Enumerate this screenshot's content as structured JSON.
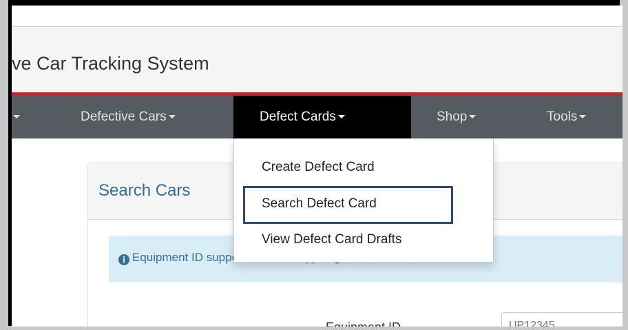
{
  "app": {
    "title": "ve Car Tracking System"
  },
  "navbar": {
    "items": [
      {
        "label": ""
      },
      {
        "label": "Defective Cars"
      },
      {
        "label": "Defect Cards"
      },
      {
        "label": "Shop"
      },
      {
        "label": "Tools"
      }
    ],
    "active_item": "Defect Cards"
  },
  "dropdown": {
    "items": [
      {
        "label": "Create Defect Card"
      },
      {
        "label": "Search Defect Card"
      },
      {
        "label": "View Defect Card Drafts"
      }
    ],
    "highlighted_item": "Search Defect Card"
  },
  "panel": {
    "title": "Search Cars",
    "alert": "Equipment ID supports wild card (*). E.g. BN*, BNSF*, B",
    "field_label": "Equipment ID",
    "field_value": "UP12345"
  },
  "colors": {
    "accent_red": "#c0272d",
    "navbar_bg": "#555b60",
    "active_nav_bg": "#000000",
    "highlight_border": "#2d4a6e",
    "info_text": "#31708f",
    "info_bg": "#d9edf7"
  },
  "icons": {
    "alert_icon": "info-circle-icon",
    "caret_icon": "caret-down-icon"
  }
}
